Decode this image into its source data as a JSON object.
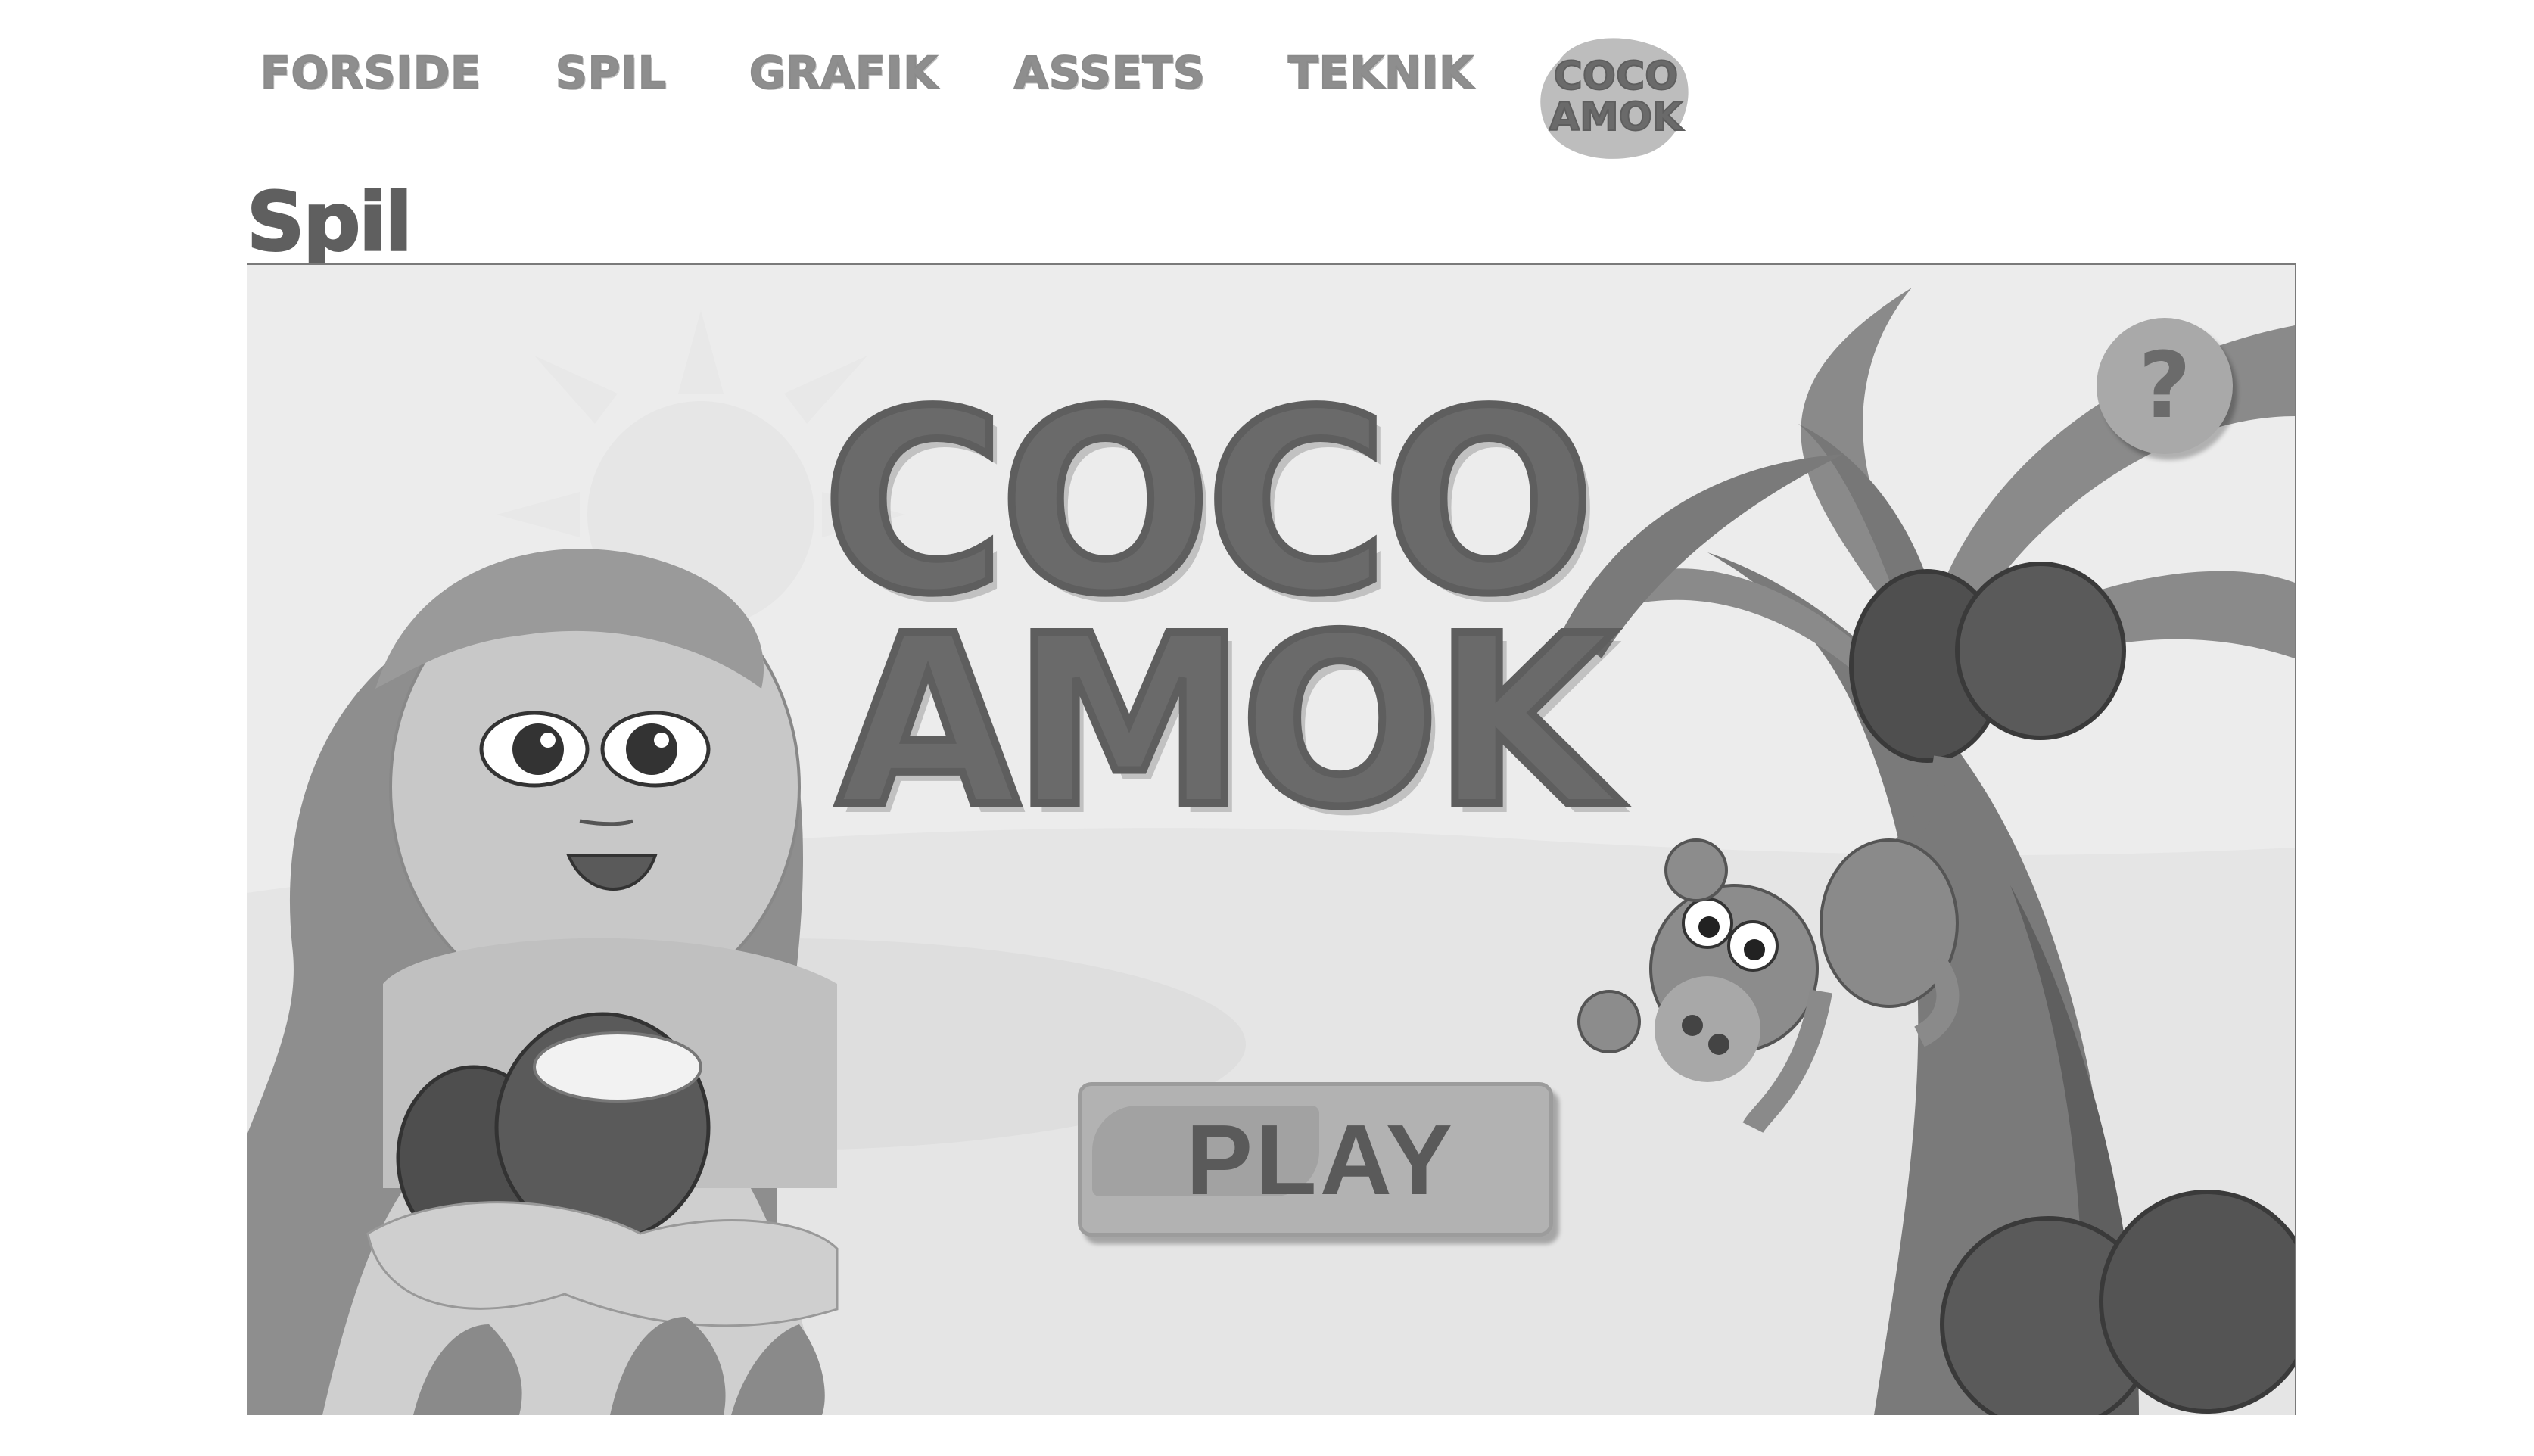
{
  "nav": {
    "items": [
      {
        "label": "FORSIDE"
      },
      {
        "label": "SPIL"
      },
      {
        "label": "GRAFIK"
      },
      {
        "label": "ASSETS"
      },
      {
        "label": "TEKNIK"
      }
    ],
    "logo": {
      "line1": "COCO",
      "line2": "AMOK"
    }
  },
  "page": {
    "title": "Spil"
  },
  "game": {
    "title_line1": "COCO",
    "title_line2": "AMOK",
    "play_label": "PLAY",
    "help_label": "?"
  }
}
